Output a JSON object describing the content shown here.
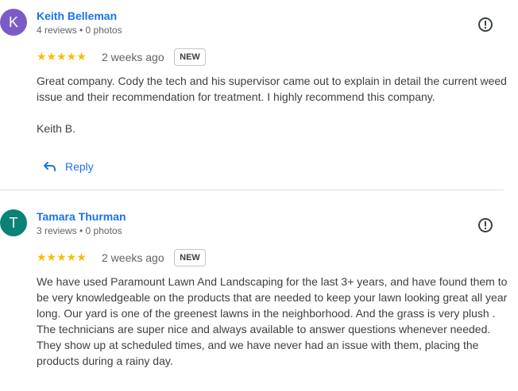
{
  "reviews": [
    {
      "avatar_letter": "K",
      "avatar_color": "#7b5cc7",
      "name": "Keith Belleman",
      "meta": "4 reviews • 0 photos",
      "stars": "★★★★★",
      "time": "2 weeks ago",
      "badge": "NEW",
      "text_p1": "Great company. Cody the tech and his supervisor came out to explain in detail the current weed issue and their recommendation for treatment. I highly recommend this company.",
      "text_p2": "Keith B.",
      "reply_label": "Reply"
    },
    {
      "avatar_letter": "T",
      "avatar_color": "#0b8276",
      "name": "Tamara Thurman",
      "meta": "3 reviews • 0 photos",
      "stars": "★★★★★",
      "time": "2 weeks ago",
      "badge": "NEW",
      "text_p1": "We have used Paramount Lawn And Landscaping for the last 3+ years, and have found them to be very knowledgeable on the products that are needed to keep your lawn looking great all year long. Our yard is one of the greenest lawns in the neighborhood. And the grass is very plush . The technicians are super nice and always available to answer questions whenever needed. They show up at scheduled times, and we have never had an issue with them, placing the products during a rainy day."
    }
  ],
  "colors": {
    "accent": "#1a73e8",
    "star": "#fbbc04",
    "icon": "#3c4043"
  }
}
